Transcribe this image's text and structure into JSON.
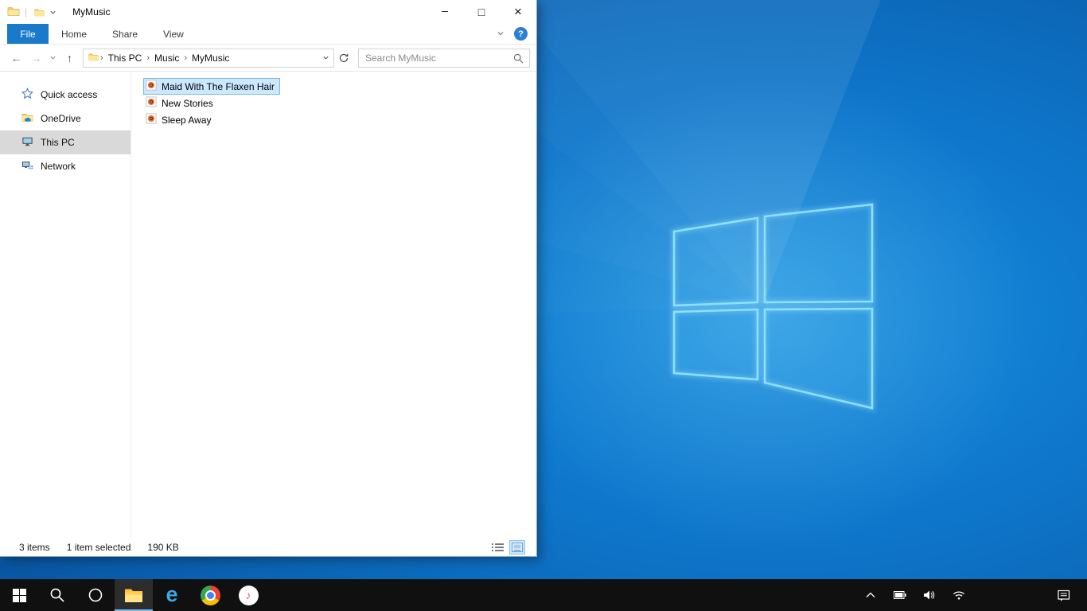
{
  "explorer": {
    "title_bar": {
      "title": "MyMusic",
      "qat_separator": "|",
      "caption": {
        "minimize": "–",
        "maximize": "□",
        "close": "×"
      }
    },
    "ribbon": {
      "tabs": [
        {
          "label": "File"
        },
        {
          "label": "Home"
        },
        {
          "label": "Share"
        },
        {
          "label": "View"
        }
      ],
      "help": "?"
    },
    "navigation": {
      "back": "←",
      "forward": "→",
      "up": "↑"
    },
    "address": {
      "crumbs": [
        {
          "label": "This PC"
        },
        {
          "label": "Music"
        },
        {
          "label": "MyMusic"
        }
      ],
      "separator": "›"
    },
    "search": {
      "placeholder": "Search MyMusic"
    },
    "sidebar": {
      "items": [
        {
          "label": "Quick access"
        },
        {
          "label": "OneDrive"
        },
        {
          "label": "This PC",
          "selected": true
        },
        {
          "label": "Network"
        }
      ]
    },
    "files": [
      {
        "name": "Maid With The Flaxen Hair",
        "selected": true
      },
      {
        "name": "New Stories",
        "selected": false
      },
      {
        "name": "Sleep Away",
        "selected": false
      }
    ],
    "status": {
      "count": "3 items",
      "selection": "1 item selected",
      "size": "190 KB"
    }
  },
  "taskbar": {
    "edge_glyph": "e",
    "itunes_glyph": "♪",
    "apps": [
      "start",
      "search",
      "cortana",
      "file-explorer",
      "edge",
      "chrome",
      "itunes"
    ],
    "tray": [
      "show-hidden-icons",
      "battery",
      "volume",
      "network",
      "action-center"
    ]
  },
  "colors": {
    "ribbon_file_tab": "#1979ca",
    "selection_fill": "#cce8ff",
    "selection_border": "#7ab8ec",
    "sidebar_selected": "#d9d9d9",
    "taskbar_bg": "#101010",
    "wallpaper_blue": "#0f72c4",
    "logo_stroke": "#8ae2ff"
  }
}
